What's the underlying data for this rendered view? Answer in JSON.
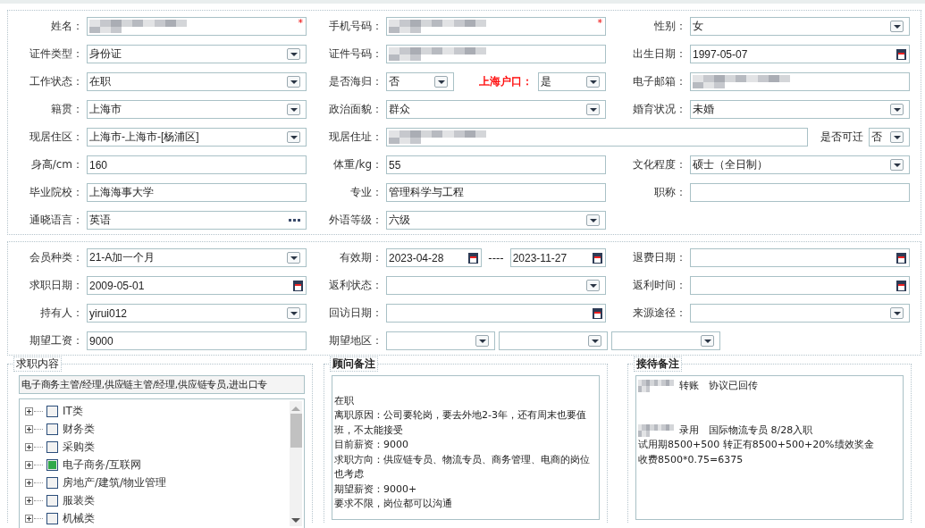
{
  "profile": {
    "rows": [
      [
        {
          "label": "姓名：",
          "items": [
            {
              "kind": "text",
              "redacted": true,
              "required_mark": "*"
            }
          ]
        },
        {
          "label": "手机号码：",
          "items": [
            {
              "kind": "text",
              "redacted": true,
              "required_mark": "*"
            }
          ]
        },
        {
          "label": "性别：",
          "items": [
            {
              "kind": "select",
              "value": "女"
            }
          ]
        }
      ],
      [
        {
          "label": "证件类型：",
          "items": [
            {
              "kind": "select",
              "value": "身份证"
            }
          ]
        },
        {
          "label": "证件号码：",
          "items": [
            {
              "kind": "text",
              "redacted": true
            }
          ]
        },
        {
          "label": "出生日期：",
          "items": [
            {
              "kind": "date",
              "value": "1997-05-07"
            }
          ]
        }
      ],
      [
        {
          "label": "工作状态：",
          "items": [
            {
              "kind": "select",
              "value": "在职"
            }
          ]
        },
        {
          "label": "是否海归：",
          "items": [
            {
              "kind": "select",
              "value": "否"
            },
            {
              "kind": "label",
              "text": "上海户口：",
              "color": "#ff0000"
            },
            {
              "kind": "select",
              "value": "是"
            }
          ]
        },
        {
          "label": "电子邮箱：",
          "items": [
            {
              "kind": "text",
              "redacted": true
            }
          ]
        }
      ],
      [
        {
          "label": "籍贯：",
          "items": [
            {
              "kind": "select",
              "value": "上海市"
            }
          ]
        },
        {
          "label": "政治面貌：",
          "items": [
            {
              "kind": "select",
              "value": "群众"
            }
          ]
        },
        {
          "label": "婚育状况：",
          "items": [
            {
              "kind": "select",
              "value": "未婚"
            }
          ]
        }
      ],
      [
        {
          "label": "现居住区：",
          "items": [
            {
              "kind": "select",
              "value": " 上海市-上海市-[杨浦区]"
            }
          ]
        },
        {
          "label": "现居住址：",
          "wide": true,
          "items": [
            {
              "kind": "text",
              "redacted": true
            },
            {
              "kind": "label",
              "text": "是否可迁"
            },
            {
              "kind": "select",
              "value": "否"
            }
          ]
        }
      ],
      [
        {
          "label": "身高/cm：",
          "items": [
            {
              "kind": "text",
              "value": "160"
            }
          ]
        },
        {
          "label": "体重/kg：",
          "items": [
            {
              "kind": "text",
              "value": "55"
            }
          ]
        },
        {
          "label": "文化程度：",
          "items": [
            {
              "kind": "select",
              "value": "硕士（全日制）"
            }
          ]
        }
      ],
      [
        {
          "label": "毕业院校：",
          "items": [
            {
              "kind": "text",
              "value": "上海海事大学"
            }
          ]
        },
        {
          "label": "专业：",
          "items": [
            {
              "kind": "text",
              "value": "管理科学与工程"
            }
          ]
        },
        {
          "label": "职称：",
          "items": [
            {
              "kind": "text"
            }
          ]
        }
      ],
      [
        {
          "label": "通晓语言：",
          "items": [
            {
              "kind": "picker",
              "value": "英语"
            }
          ]
        },
        {
          "label": "外语等级：",
          "items": [
            {
              "kind": "select",
              "value": "六级"
            }
          ]
        }
      ]
    ]
  },
  "membership": {
    "rows": [
      [
        {
          "label": "会员种类：",
          "items": [
            {
              "kind": "select",
              "value": " 21-A加一个月"
            }
          ]
        },
        {
          "label": "有效期：",
          "items": [
            {
              "kind": "date",
              "value": "2023-04-28"
            },
            {
              "kind": "dash",
              "text": "----"
            },
            {
              "kind": "date",
              "value": "2023-11-27"
            }
          ]
        },
        {
          "label": "退费日期：",
          "items": [
            {
              "kind": "date"
            }
          ]
        }
      ],
      [
        {
          "label": "求职日期：",
          "items": [
            {
              "kind": "date",
              "value": "2009-05-01"
            }
          ]
        },
        {
          "label": "返利状态：",
          "items": [
            {
              "kind": "select"
            }
          ]
        },
        {
          "label": "返利时间：",
          "items": [
            {
              "kind": "date"
            }
          ]
        }
      ],
      [
        {
          "label": "持有人：",
          "items": [
            {
              "kind": "select",
              "value": "yirui012"
            }
          ]
        },
        {
          "label": "回访日期：",
          "items": [
            {
              "kind": "date"
            }
          ]
        },
        {
          "label": "来源途径：",
          "items": [
            {
              "kind": "select"
            }
          ]
        }
      ],
      [
        {
          "label": "期望工资：",
          "items": [
            {
              "kind": "text",
              "value": "9000"
            }
          ]
        },
        {
          "label": "期望地区：",
          "wide": true,
          "items": [
            {
              "kind": "select"
            },
            {
              "kind": "select"
            },
            {
              "kind": "select"
            }
          ]
        }
      ]
    ]
  },
  "job_panel": {
    "legend": "求职内容",
    "summary": "电子商务主管/经理,供应链主管/经理,供应链专员,进出口专",
    "tree": [
      {
        "label": "IT类",
        "checked": false
      },
      {
        "label": "财务类",
        "checked": false
      },
      {
        "label": "采购类",
        "checked": false
      },
      {
        "label": "电子商务/互联网",
        "checked": true
      },
      {
        "label": "房地产/建筑/物业管理",
        "checked": false
      },
      {
        "label": "服装类",
        "checked": false
      },
      {
        "label": "机械类",
        "checked": false
      }
    ]
  },
  "advisor_notes": {
    "legend": "顾问备注",
    "lines": [
      {
        "gap_before": true,
        "text": "在职"
      },
      {
        "text": "离职原因：公司要轮岗，要去外地2-3年，还有周末也要值班，不太能接受"
      },
      {
        "text": "目前薪资：9000"
      },
      {
        "text": "求职方向：供应链专员、物流专员、商务管理、电商的岗位也考虑"
      },
      {
        "text": "期望薪资：9000+"
      },
      {
        "text": "要求不限，岗位都可以沟通"
      }
    ]
  },
  "reception_notes": {
    "legend": "接待备注",
    "lines": [
      {
        "redacted": true,
        "text": "转账　协议已回传"
      },
      {
        "gap_before": true,
        "redacted": true,
        "text": "录用　国际物流专员 8/28入职"
      },
      {
        "text": "试用期8500+500 转正有8500+500+20%绩效奖金"
      },
      {
        "text": "收费8500*0.75=6375"
      }
    ]
  }
}
